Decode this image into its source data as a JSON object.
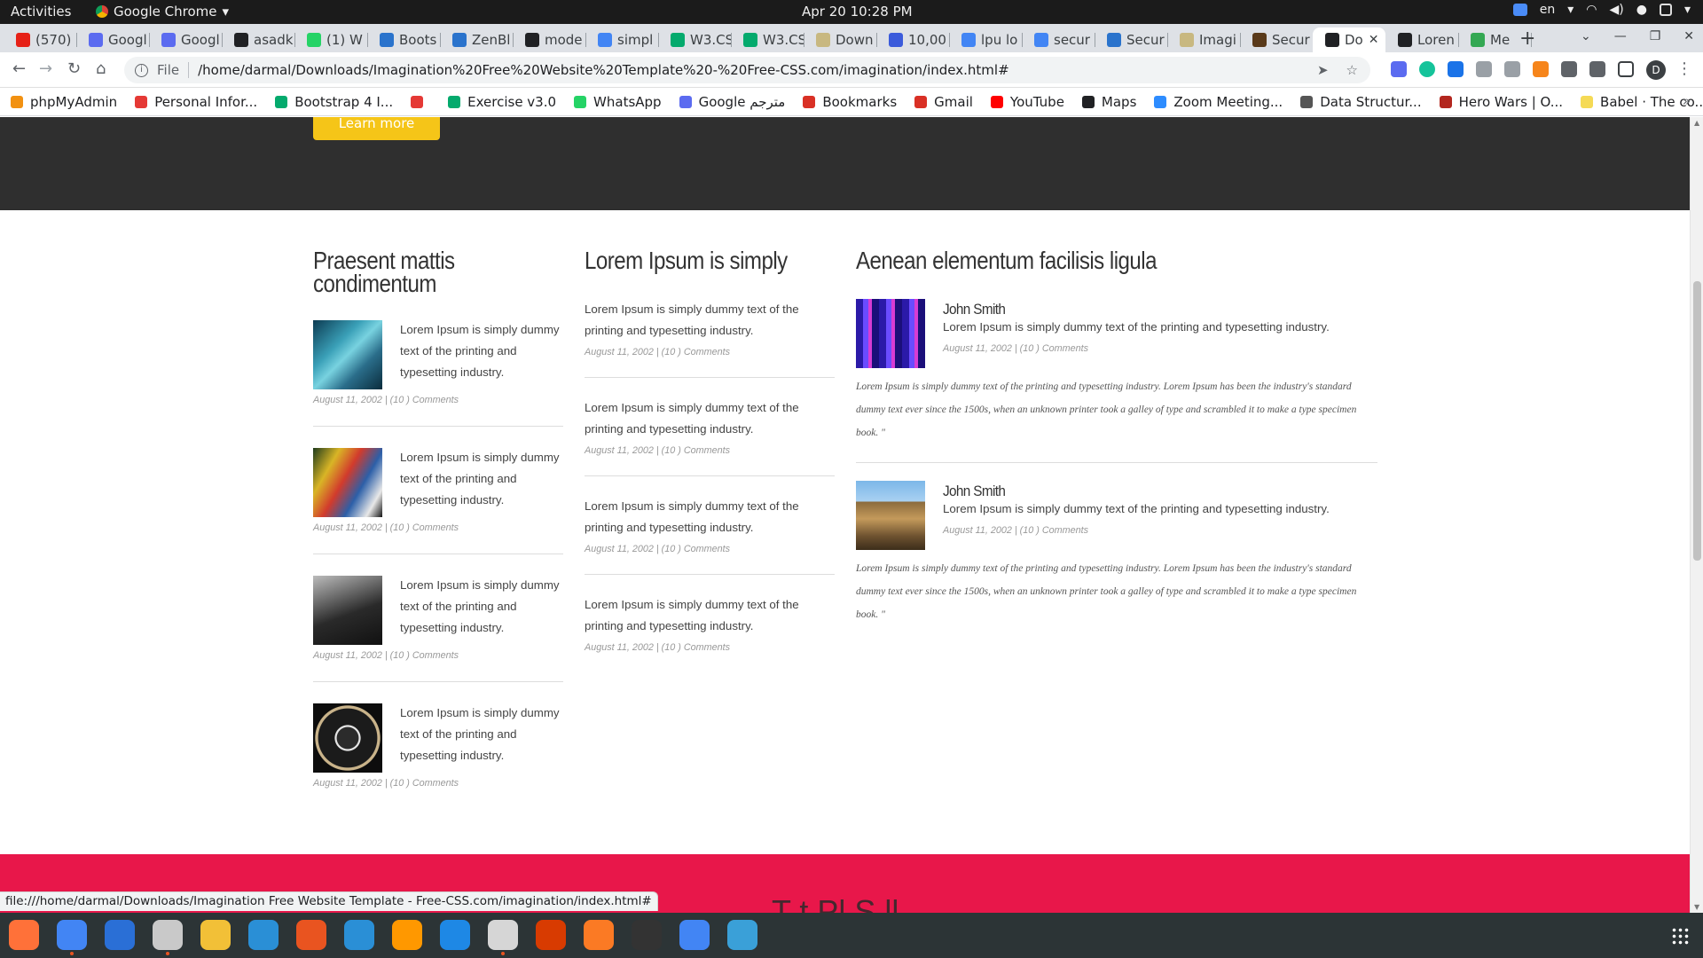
{
  "system": {
    "activities": "Activities",
    "app_name": "Google Chrome",
    "clock": "Apr 20  10:28 PM",
    "language": "en"
  },
  "tabs": [
    {
      "label": "(570)",
      "color": "#e62117"
    },
    {
      "label": "Googl",
      "color": "#5b6bf0"
    },
    {
      "label": "Googl",
      "color": "#5b6bf0"
    },
    {
      "label": "asadk",
      "color": "#202124"
    },
    {
      "label": "(1) W",
      "color": "#25d366"
    },
    {
      "label": "Boots",
      "color": "#2a73cc"
    },
    {
      "label": "ZenBl",
      "color": "#2a73cc"
    },
    {
      "label": "mode",
      "color": "#202124"
    },
    {
      "label": "simpl",
      "color": "#4285f4"
    },
    {
      "label": "W3.CS",
      "color": "#04aa6d"
    },
    {
      "label": "W3.CS",
      "color": "#04aa6d"
    },
    {
      "label": "Down",
      "color": "#c8b880"
    },
    {
      "label": "10,00",
      "color": "#3b5bdb"
    },
    {
      "label": "lpu lo",
      "color": "#4285f4"
    },
    {
      "label": "secur",
      "color": "#4285f4"
    },
    {
      "label": "Secur",
      "color": "#2a73cc"
    },
    {
      "label": "Imagi",
      "color": "#c8b880"
    },
    {
      "label": "Secur",
      "color": "#5a3a1a"
    },
    {
      "label": "Do",
      "color": "#202124",
      "active": true
    },
    {
      "label": "Loren",
      "color": "#202124"
    },
    {
      "label": "Me",
      "color": "#34a853"
    }
  ],
  "address": {
    "scheme": "File",
    "url": "/home/darmal/Downloads/Imagination%20Free%20Website%20Template%20-%20Free-CSS.com/imagination/index.html#"
  },
  "profile_initial": "D",
  "bookmarks": [
    {
      "label": "phpMyAdmin",
      "color": "#f29111"
    },
    {
      "label": "Personal Infor...",
      "color": "#e53935"
    },
    {
      "label": "Bootstrap 4 I...",
      "color": "#04aa6d"
    },
    {
      "label": "",
      "color": "#e53935"
    },
    {
      "label": "Exercise v3.0",
      "color": "#04aa6d"
    },
    {
      "label": "WhatsApp",
      "color": "#25d366"
    },
    {
      "label": "Google مترجم",
      "color": "#5b6bf0"
    },
    {
      "label": "Bookmarks",
      "color": "#d93025"
    },
    {
      "label": "Gmail",
      "color": "#d93025"
    },
    {
      "label": "YouTube",
      "color": "#ff0000"
    },
    {
      "label": "Maps",
      "color": "#202124"
    },
    {
      "label": "Zoom Meeting...",
      "color": "#2d8cff"
    },
    {
      "label": "Data Structur...",
      "color": "#555555"
    },
    {
      "label": "Hero Wars | O...",
      "color": "#b3261e"
    },
    {
      "label": "Babel · The co...",
      "color": "#f5da55"
    }
  ],
  "page": {
    "learn_more": "Learn more",
    "col1": {
      "title": "Praesent mattis condimentum",
      "posts": [
        {
          "text": "Lorem Ipsum is simply dummy text of the printing and typesetting industry.",
          "meta": "August 11, 2002 | (10 ) Comments"
        },
        {
          "text": "Lorem Ipsum is simply dummy text of the printing and typesetting industry.",
          "meta": "August 11, 2002 | (10 ) Comments"
        },
        {
          "text": "Lorem Ipsum is simply dummy text of the printing and typesetting industry.",
          "meta": "August 11, 2002 | (10 ) Comments"
        },
        {
          "text": "Lorem Ipsum is simply dummy text of the printing and typesetting industry.",
          "meta": "August 11, 2002 | (10 ) Comments"
        }
      ]
    },
    "col2": {
      "title": "Lorem Ipsum is simply",
      "posts": [
        {
          "text": "Lorem Ipsum is simply dummy text of the printing and typesetting industry.",
          "meta": "August 11, 2002 | (10 ) Comments"
        },
        {
          "text": "Lorem Ipsum is simply dummy text of the printing and typesetting industry.",
          "meta": "August 11, 2002 | (10 ) Comments"
        },
        {
          "text": "Lorem Ipsum is simply dummy text of the printing and typesetting industry.",
          "meta": "August 11, 2002 | (10 ) Comments"
        },
        {
          "text": "Lorem Ipsum is simply dummy text of the printing and typesetting industry.",
          "meta": "August 11, 2002 | (10 ) Comments"
        }
      ]
    },
    "col3": {
      "title": "Aenean elementum facilisis ligula",
      "testimonials": [
        {
          "author": "John Smith",
          "text": "Lorem Ipsum is simply dummy text of the printing and typesetting industry.",
          "meta": "August 11, 2002 | (10 ) Comments",
          "quote": "Lorem Ipsum is simply dummy text of the printing and typesetting industry. Lorem Ipsum has been the industry's standard dummy text ever since the 1500s, when an unknown printer took a galley of type and scrambled it to make a type specimen book. \""
        },
        {
          "author": "John Smith",
          "text": "Lorem Ipsum is simply dummy text of the printing and typesetting industry.",
          "meta": "August 11, 2002 | (10 ) Comments",
          "quote": "Lorem Ipsum is simply dummy text of the printing and typesetting industry. Lorem Ipsum has been the industry's standard dummy text ever since the 1500s, when an unknown printer took a galley of type and scrambled it to make a type specimen book. \""
        }
      ]
    },
    "red_band_peek": "T          t Pl     S  ll"
  },
  "status_url": "file:///home/darmal/Downloads/Imagination Free Website Template - Free-CSS.com/imagination/index.html#",
  "dock": [
    {
      "name": "firefox",
      "color": "#ff7139"
    },
    {
      "name": "chrome",
      "color": "#4285f4",
      "running": true
    },
    {
      "name": "thunderbird",
      "color": "#2a6fd6"
    },
    {
      "name": "files",
      "color": "#c9c9c9",
      "running": true
    },
    {
      "name": "rhythmbox",
      "color": "#f2c037"
    },
    {
      "name": "writer",
      "color": "#2a8fd6"
    },
    {
      "name": "software",
      "color": "#e95420"
    },
    {
      "name": "help",
      "color": "#2a8fd6"
    },
    {
      "name": "sublime",
      "color": "#ff9800"
    },
    {
      "name": "vscode",
      "color": "#1e88e5"
    },
    {
      "name": "terminal-app",
      "color": "#d6d6d6",
      "running": true
    },
    {
      "name": "office",
      "color": "#d83b01"
    },
    {
      "name": "xampp",
      "color": "#fb7a24"
    },
    {
      "name": "terminal",
      "color": "#333333"
    },
    {
      "name": "translate",
      "color": "#4285f4"
    },
    {
      "name": "screenshot",
      "color": "#3aa0d8"
    }
  ]
}
